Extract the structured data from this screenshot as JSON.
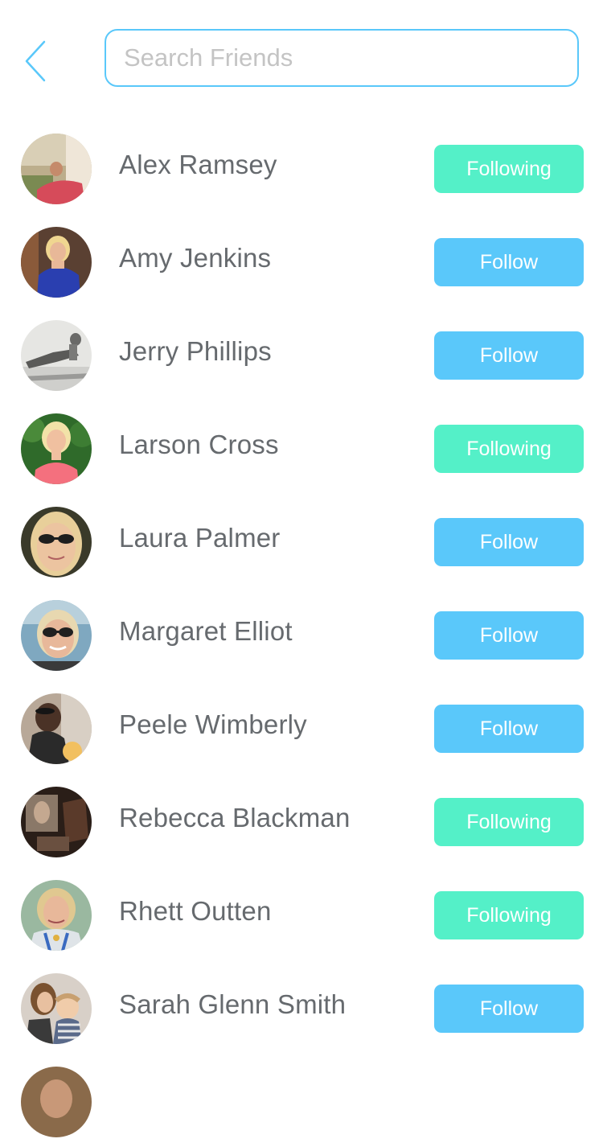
{
  "header": {
    "back_icon": "chevron-left-icon",
    "search_placeholder": "Search Friends",
    "search_value": ""
  },
  "colors": {
    "accent": "#5ac8fa",
    "follow_button": "#5ac8fa",
    "following_button": "#54f0c8",
    "name_text": "#666a6e"
  },
  "friends": [
    {
      "name": "Alex Ramsey",
      "button": "Following",
      "state": "following"
    },
    {
      "name": "Amy Jenkins",
      "button": "Follow",
      "state": "follow"
    },
    {
      "name": "Jerry Phillips",
      "button": "Follow",
      "state": "follow"
    },
    {
      "name": "Larson Cross",
      "button": "Following",
      "state": "following"
    },
    {
      "name": "Laura Palmer",
      "button": "Follow",
      "state": "follow"
    },
    {
      "name": "Margaret Elliot",
      "button": "Follow",
      "state": "follow"
    },
    {
      "name": "Peele Wimberly",
      "button": "Follow",
      "state": "follow"
    },
    {
      "name": "Rebecca Blackman",
      "button": "Following",
      "state": "following"
    },
    {
      "name": "Rhett Outten",
      "button": "Following",
      "state": "following"
    },
    {
      "name": "Sarah Glenn Smith",
      "button": "Follow",
      "state": "follow"
    }
  ]
}
